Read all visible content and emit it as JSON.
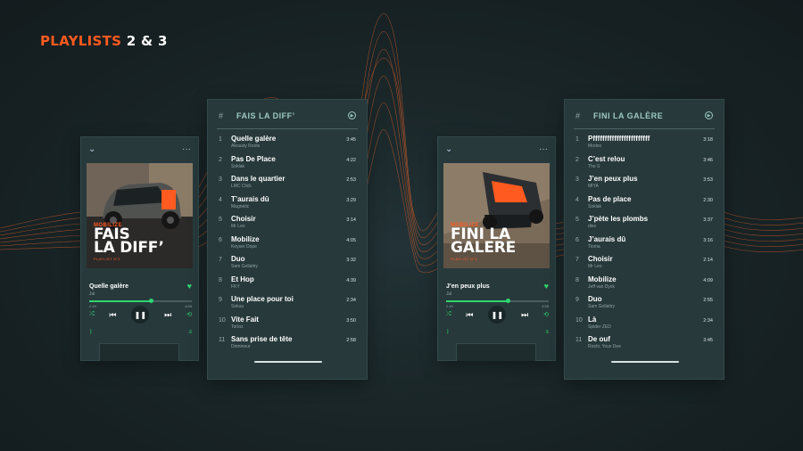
{
  "page": {
    "title_text": "PLAYLISTS",
    "title_numbers": "2 & 3"
  },
  "colors": {
    "accent": "#ff5a1f",
    "green": "#2fd66f",
    "panel": "#27393b",
    "background": "#1a2628",
    "header_teal": "#9cc9c4"
  },
  "players": [
    {
      "cover": {
        "brand": "MOBILIZE",
        "line1": "FAIS",
        "line2": "LA DIFF’",
        "sub": "PLAYLIST N°2"
      },
      "now_playing": {
        "title": "Quelle galère",
        "artist": "Jul",
        "elapsed": "2:49",
        "total": "4:55",
        "progress": 0.6
      },
      "icons": [
        "chevron-down-icon",
        "more-icon",
        "heart-icon",
        "shuffle-icon",
        "previous-icon",
        "pause-icon",
        "next-icon",
        "repeat-icon",
        "bluetooth-icon",
        "queue-icon"
      ]
    },
    {
      "cover": {
        "brand": "MOBILIZE",
        "line1": "FINI LA",
        "line2": "GALERE",
        "sub": "PLAYLIST N°3"
      },
      "now_playing": {
        "title": "J’en peux plus",
        "artist": "Jul",
        "elapsed": "2:49",
        "total": "4:55",
        "progress": 0.6
      },
      "icons": [
        "chevron-down-icon",
        "more-icon",
        "heart-icon",
        "shuffle-icon",
        "previous-icon",
        "pause-icon",
        "next-icon",
        "repeat-icon",
        "bluetooth-icon",
        "queue-icon"
      ]
    }
  ],
  "playlists": [
    {
      "header_hash": "#",
      "name": "FAIS LA DIFF’",
      "tracks": [
        {
          "num": "1",
          "title": "Quelle galère",
          "artist": "Akousty Roots",
          "duration": "3:45"
        },
        {
          "num": "2",
          "title": "Pas De Place",
          "artist": "Soklak",
          "duration": "4:22"
        },
        {
          "num": "3",
          "title": "Dans le quartier",
          "artist": "LMC Click",
          "duration": "2:53"
        },
        {
          "num": "4",
          "title": "T’aurais dû",
          "artist": "Magnetic",
          "duration": "3:29"
        },
        {
          "num": "5",
          "title": "Choisir",
          "artist": "Mr Leo",
          "duration": "3:14"
        },
        {
          "num": "6",
          "title": "Mobilize",
          "artist": "Keyser Dope",
          "duration": "4:05"
        },
        {
          "num": "7",
          "title": "Duo",
          "artist": "Sam Gellaitry",
          "duration": "3:32"
        },
        {
          "num": "8",
          "title": "Et Hop",
          "artist": "FKY",
          "duration": "4:39"
        },
        {
          "num": "9",
          "title": "Une place pour toi",
          "artist": "Sokuu",
          "duration": "2:34"
        },
        {
          "num": "10",
          "title": "Vite Fait",
          "artist": "Tortoz",
          "duration": "3:50"
        },
        {
          "num": "11",
          "title": "Sans prise de tête",
          "artist": "Demineur",
          "duration": "2:58"
        }
      ]
    },
    {
      "header_hash": "#",
      "name": "FINI LA GALÈRE",
      "tracks": [
        {
          "num": "1",
          "title": "Pffffffffffffffffffffffff",
          "artist": "Modox",
          "duration": "3:18"
        },
        {
          "num": "2",
          "title": "C’est relou",
          "artist": "The S",
          "duration": "3:46"
        },
        {
          "num": "3",
          "title": "J’en peux plus",
          "artist": "MIYA",
          "duration": "3:53"
        },
        {
          "num": "4",
          "title": "Pas de place",
          "artist": "Soklak",
          "duration": "2:30"
        },
        {
          "num": "5",
          "title": "J’pète les plombs",
          "artist": "diez",
          "duration": "3:37"
        },
        {
          "num": "6",
          "title": "J’aurais dû",
          "artist": "Tioma",
          "duration": "3:16"
        },
        {
          "num": "7",
          "title": "Choisir",
          "artist": "Mr Leo",
          "duration": "2:14"
        },
        {
          "num": "8",
          "title": "Mobilize",
          "artist": "Jeff van Dyck",
          "duration": "4:09"
        },
        {
          "num": "9",
          "title": "Duo",
          "artist": "Sam Gellaitry",
          "duration": "2:55"
        },
        {
          "num": "10",
          "title": "Là",
          "artist": "Spider ZED",
          "duration": "2:34"
        },
        {
          "num": "11",
          "title": "De ouf",
          "artist": "Roshi, Youv Dee",
          "duration": "3:45"
        }
      ]
    }
  ]
}
